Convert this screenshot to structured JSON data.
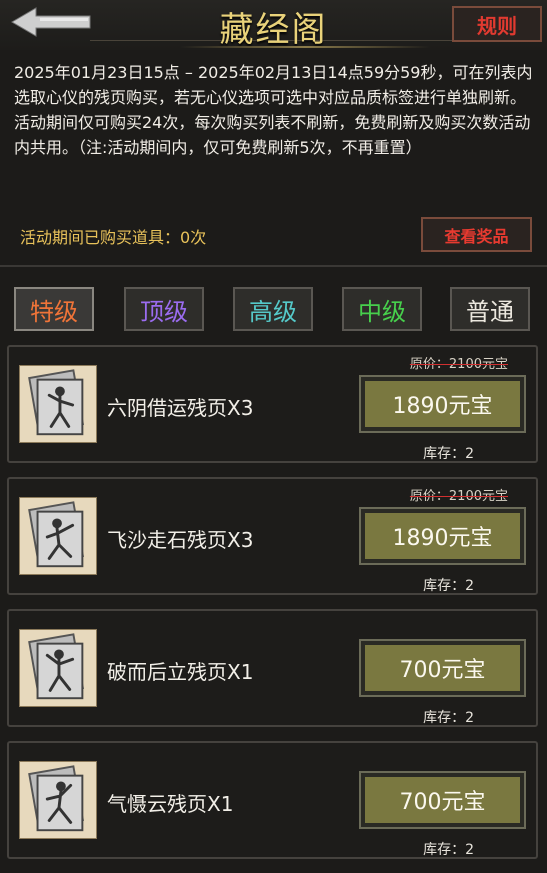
{
  "header": {
    "title": "藏经阁",
    "rules_label": "规则"
  },
  "description": "2025年01月23日15点 – 2025年02月13日14点59分59秒，可在列表内选取心仪的残页购买，若无心仪选项可选中对应品质标签进行单独刷新。活动期间仅可购买24次，每次购买列表不刷新，免费刷新及购买次数活动内共用。（注:活动期间内，仅可免费刷新5次，不再重置）",
  "purchase_status": {
    "label": "活动期间已购买道具：",
    "count": "0次"
  },
  "view_rewards_label": "查看奖品",
  "tabs": [
    {
      "label": "特级",
      "color": "#f07438"
    },
    {
      "label": "顶级",
      "color": "#9b6cf0"
    },
    {
      "label": "高级",
      "color": "#55c9c9"
    },
    {
      "label": "中级",
      "color": "#47d04c"
    },
    {
      "label": "普通",
      "color": "#ece8df"
    }
  ],
  "items": [
    {
      "name": "六阴借运残页X3",
      "original_price": "原价：2100元宝",
      "price": "1890元宝",
      "stock": "库存：2"
    },
    {
      "name": "飞沙走石残页X3",
      "original_price": "原价：2100元宝",
      "price": "1890元宝",
      "stock": "库存：2"
    },
    {
      "name": "破而后立残页X1",
      "original_price": "",
      "price": "700元宝",
      "stock": "库存：2"
    },
    {
      "name": "气慑云残页X1",
      "original_price": "",
      "price": "700元宝",
      "stock": "库存：2"
    }
  ],
  "colors": {
    "title": "#e9d27a",
    "alert_red": "#e23a30",
    "buy_button": "#7a7840",
    "highlight": "#e8c25a"
  },
  "icons": {
    "back": "back-arrow-icon",
    "item": "martial-arts-scroll-icon"
  }
}
